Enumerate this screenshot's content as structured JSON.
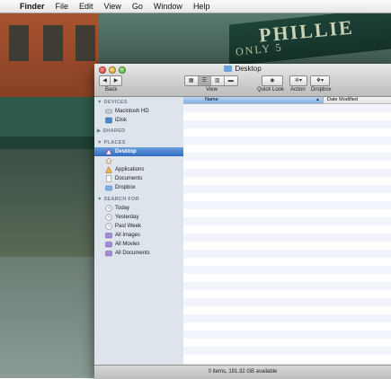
{
  "menubar": {
    "apple": "",
    "app_name": "Finder",
    "items": [
      "File",
      "Edit",
      "View",
      "Go",
      "Window",
      "Help"
    ]
  },
  "wallpaper": {
    "sign_text": "PHILLIE",
    "sign_subtext": "ONLY 5"
  },
  "window": {
    "title": "Desktop",
    "toolbar": {
      "back_label": "Back",
      "view_label": "View",
      "quicklook_label": "Quick Look",
      "action_label": "Action",
      "dropbox_label": "Dropbox"
    },
    "sidebar": {
      "devices_label": "DEVICES",
      "devices": [
        "Macintosh HD",
        "iDisk"
      ],
      "shared_label": "SHARED",
      "places_label": "PLACES",
      "places": [
        "Desktop",
        "",
        "Applications",
        "Documents",
        "Dropbox"
      ],
      "search_label": "SEARCH FOR",
      "searches": [
        "Today",
        "Yesterday",
        "Past Week",
        "All Images",
        "All Movies",
        "All Documents"
      ]
    },
    "columns": {
      "name": "Name",
      "date_modified": "Date Modified"
    },
    "status": "0 items, 191.32 GB available"
  },
  "colors": {
    "selection": "#2f6cc2",
    "sidebar_bg": "#dde4ec",
    "stripe": "#f1f5fb"
  }
}
